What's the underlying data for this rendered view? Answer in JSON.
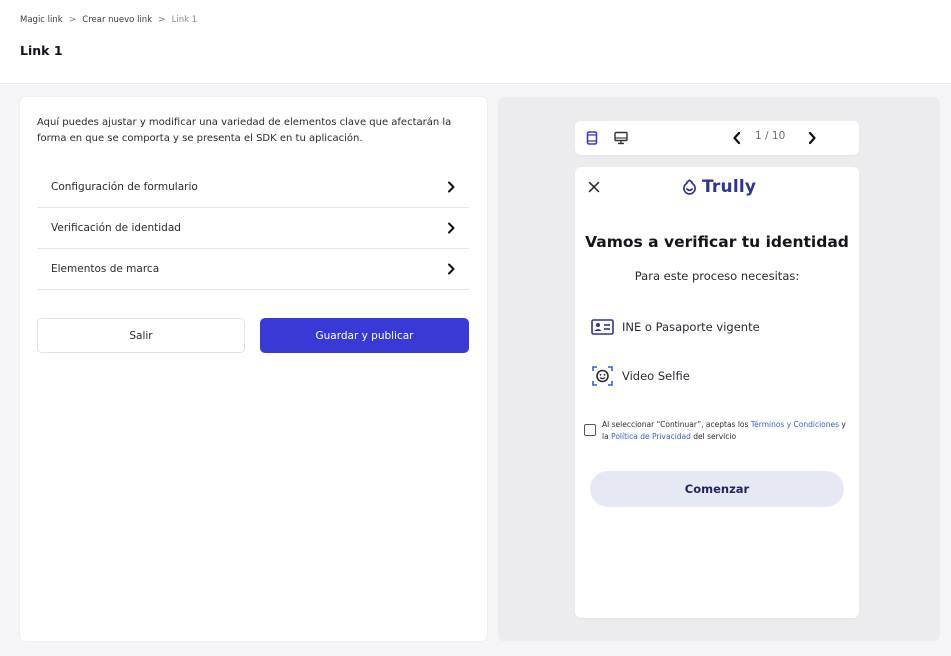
{
  "breadcrumb": {
    "items": [
      "Magic link",
      "Crear nuevo link",
      "Link 1"
    ],
    "separator": ">"
  },
  "page": {
    "title": "Link 1"
  },
  "config_panel": {
    "intro": "Aquí puedes ajustar y modificar una variedad de elementos clave que afectarán la forma en que se comporta y se presenta el SDK en tu aplicación.",
    "menu": [
      {
        "label": "Configuración de formulario",
        "icon": "chevron-right-icon"
      },
      {
        "label": "Verificación de identidad",
        "icon": "chevron-right-icon"
      },
      {
        "label": "Elementos de marca",
        "icon": "chevron-right-icon"
      }
    ],
    "exit_label": "Salir",
    "save_label": "Guardar y publicar"
  },
  "preview": {
    "toolbar": {
      "page_indicator": "1 / 10",
      "icons": [
        "mobile-view-icon",
        "desktop-view-icon",
        "chevron-left-icon",
        "chevron-right-icon"
      ]
    },
    "screen": {
      "brand": "Trully",
      "heading": "Vamos a verificar tu identidad",
      "subheading": "Para este proceso necesitas:",
      "requirements": [
        {
          "label": "INE o Pasaporte vigente",
          "icon": "id-card-icon"
        },
        {
          "label": "Video Selfie",
          "icon": "face-scan-icon"
        }
      ],
      "consent": {
        "prefix": "Al seleccionar “Continuar”, aceptas los ",
        "terms_link": "Términos y Condiciones",
        "middle": " y la ",
        "privacy_link": "Política de Privacidad",
        "suffix": " del servicio"
      },
      "start_label": "Comenzar"
    }
  },
  "colors": {
    "primary_button": "#3939d8",
    "brand_navy": "#2c3591",
    "link_blue": "#3c5ad8",
    "panel_bg": "#ececef",
    "start_button_bg": "#e6e8f4"
  }
}
